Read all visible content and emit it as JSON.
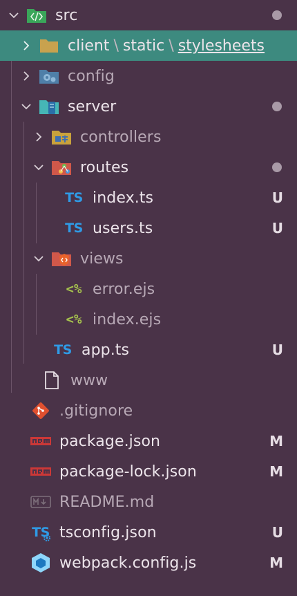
{
  "explorer": {
    "root": {
      "name": "src"
    },
    "breadcrumb": {
      "part1": "client",
      "sep1": "\\",
      "part2": "static",
      "sep2": "\\",
      "part3": "stylesheets"
    },
    "items": {
      "config": "config",
      "server": "server",
      "controllers": "controllers",
      "routes": "routes",
      "index_ts": "index.ts",
      "users_ts": "users.ts",
      "views": "views",
      "error_ejs": "error.ejs",
      "index_ejs": "index.ejs",
      "app_ts": "app.ts",
      "www": "www",
      "gitignore": ".gitignore",
      "package_json": "package.json",
      "package_lock": "package-lock.json",
      "readme": "README.md",
      "tsconfig": "tsconfig.json",
      "webpack": "webpack.config.js"
    },
    "status": {
      "index_ts": "U",
      "users_ts": "U",
      "app_ts": "U",
      "package_json": "M",
      "package_lock": "M",
      "tsconfig": "U",
      "webpack": "M"
    },
    "icons": {
      "ts": "TS",
      "ejs": "<%"
    }
  },
  "colors": {
    "background": "#4a3348",
    "selected": "#3d8a7f",
    "typescript": "#2f9be6",
    "ejs": "#a6c24e",
    "git": "#e0502f",
    "npm": "#cb3837"
  }
}
